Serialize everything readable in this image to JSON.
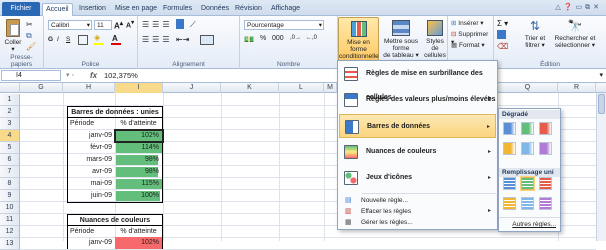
{
  "tabs": {
    "file": "Fichier",
    "home": "Accueil",
    "insert": "Insertion",
    "layout": "Mise en page",
    "formulas": "Formules",
    "data": "Données",
    "review": "Révision",
    "view": "Affichage"
  },
  "ribbon": {
    "paste_label": "Coller",
    "font_name": "Calibri",
    "font_size": "11",
    "bold": "G",
    "italic": "I",
    "underline": "S",
    "number_format": "Pourcentage",
    "cond_format_line1": "Mise en forme",
    "cond_format_line2": "conditionnelle",
    "format_table_line1": "Mettre sous forme",
    "format_table_line2": "de tableau",
    "cell_styles_line1": "Styles de",
    "cell_styles_line2": "cellules",
    "insert": "Insérer",
    "delete": "Supprimer",
    "format": "Format",
    "sort_line1": "Trier et",
    "sort_line2": "filtrer",
    "find_line1": "Rechercher et",
    "find_line2": "sélectionner",
    "groups": {
      "clipboard": "Presse-papiers",
      "font": "Police",
      "align": "Alignement",
      "number": "Nombre",
      "edit": "Édition"
    }
  },
  "formula_bar": {
    "cell_ref": "I4",
    "fx": "fx",
    "value": "102,375%"
  },
  "columns": [
    "G",
    "H",
    "I",
    "J",
    "K",
    "L",
    "M",
    "Q",
    "R"
  ],
  "rows": [
    "1",
    "2",
    "3",
    "4",
    "5",
    "6",
    "7",
    "8",
    "9",
    "10",
    "11",
    "12",
    "13"
  ],
  "table1": {
    "title": "Barres de données : unies",
    "h_period": "Période",
    "h_pct": "% d'atteinte",
    "rows": [
      {
        "period": "janv-09",
        "pct": "102%",
        "fill": 1.0
      },
      {
        "period": "févr-09",
        "pct": "114%",
        "fill": 1.0
      },
      {
        "period": "mars-09",
        "pct": "98%",
        "fill": 0.92
      },
      {
        "period": "avr-09",
        "pct": "98%",
        "fill": 0.92
      },
      {
        "period": "mai-09",
        "pct": "115%",
        "fill": 1.0
      },
      {
        "period": "juin-09",
        "pct": "100%",
        "fill": 0.95
      }
    ]
  },
  "table2": {
    "title": "Nuances de couleurs",
    "h_period": "Période",
    "h_pct": "% d'atteinte",
    "row1_period": "janv-09",
    "row1_pct": "102%"
  },
  "menu": {
    "items": [
      "Règles de mise en surbrillance des cellules",
      "Règles des valeurs plus/moins élevées",
      "Barres de données",
      "Nuances de couleurs",
      "Jeux d'icônes"
    ],
    "small": [
      "Nouvelle règle...",
      "Effacer les règles",
      "Gérer les règles..."
    ]
  },
  "submenu": {
    "gradient": "Dégradé",
    "solid": "Remplissage uni",
    "more": "Autres règles..."
  },
  "colors": {
    "accent": "#2a67b4",
    "highlight": "#fbd57f",
    "bar_green": "#63be7b"
  }
}
